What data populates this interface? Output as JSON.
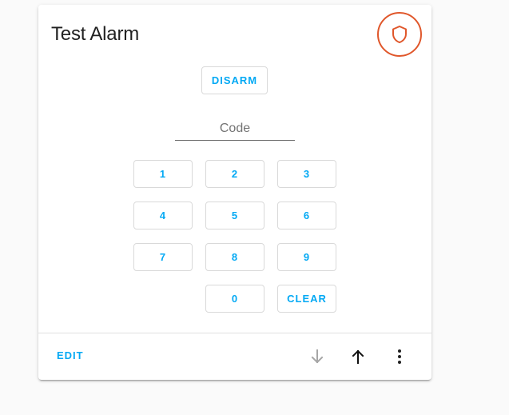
{
  "card": {
    "title": "Test Alarm",
    "state_icon": "shield-outline-icon",
    "state_color": "#e0572b"
  },
  "actions": {
    "disarm_label": "DISARM"
  },
  "code_input": {
    "placeholder": "Code",
    "value": ""
  },
  "keypad": {
    "keys": [
      "1",
      "2",
      "3",
      "4",
      "5",
      "6",
      "7",
      "8",
      "9",
      "0"
    ],
    "clear_label": "CLEAR"
  },
  "footer": {
    "edit_label": "EDIT",
    "icons": [
      "arrow-down-icon",
      "arrow-up-icon",
      "more-vertical-icon"
    ]
  },
  "colors": {
    "accent": "#03a9f4",
    "alarm": "#e0572b"
  }
}
